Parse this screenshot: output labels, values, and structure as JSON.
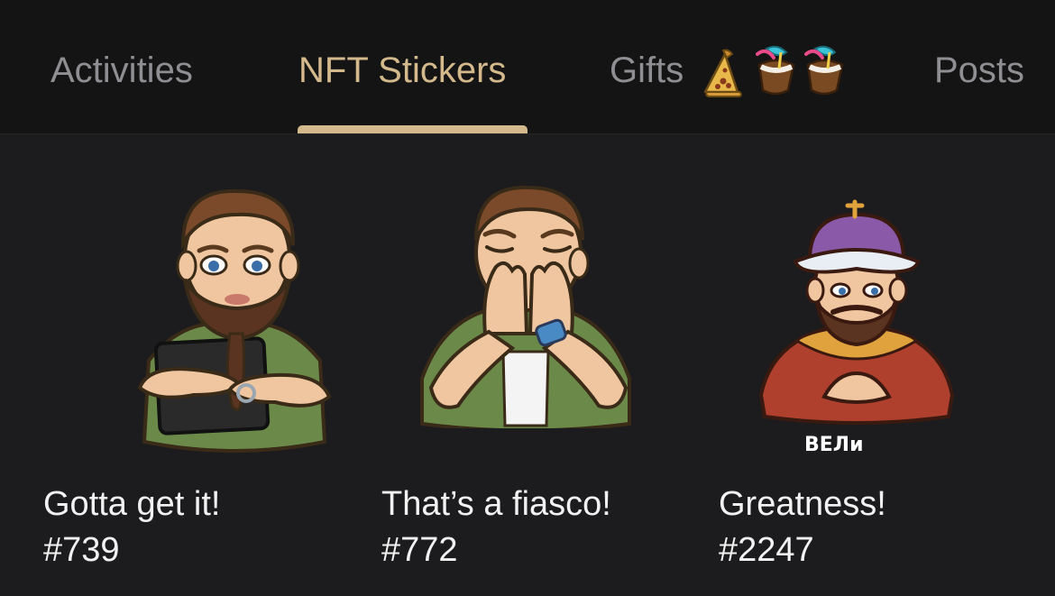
{
  "tabs": [
    {
      "label": "Activities",
      "active": false
    },
    {
      "label": "NFT Stickers",
      "active": true
    },
    {
      "label": "Gifts",
      "active": false,
      "icons": [
        "pizza-slice-icon",
        "coconut-drink-icon",
        "coconut-drink-icon"
      ]
    },
    {
      "label": "Posts",
      "active": false
    }
  ],
  "accent_color": "#d4b98c",
  "stickers": [
    {
      "title": "Gotta get it!",
      "number": "#739",
      "icon": "bearded-man-holding-tablet-sticker"
    },
    {
      "title": "That’s a fiasco!",
      "number": "#772",
      "icon": "bearded-man-facepalm-sticker"
    },
    {
      "title": "Greatness!",
      "number": "#2247",
      "icon": "bearded-king-sticker",
      "badge_text": "ВЕЛи"
    }
  ]
}
